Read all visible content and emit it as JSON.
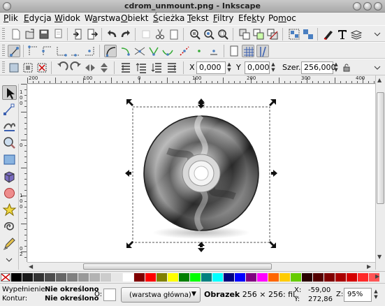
{
  "window": {
    "title": "cdrom_unmount.png - Inkscape"
  },
  "menu": [
    {
      "pre": "",
      "ul": "P",
      "post": "lik"
    },
    {
      "pre": "",
      "ul": "E",
      "post": "dycja"
    },
    {
      "pre": "",
      "ul": "W",
      "post": "idok"
    },
    {
      "pre": "W",
      "ul": "a",
      "post": "rstwa"
    },
    {
      "pre": "",
      "ul": "O",
      "post": "biekt"
    },
    {
      "pre": "",
      "ul": "Ś",
      "post": "cieżka"
    },
    {
      "pre": "",
      "ul": "T",
      "post": "ekst"
    },
    {
      "pre": "",
      "ul": "F",
      "post": "iltry"
    },
    {
      "pre": "Efe",
      "ul": "k",
      "post": "ty"
    },
    {
      "pre": "Po",
      "ul": "m",
      "post": "oc"
    }
  ],
  "controls": {
    "x_label": "X",
    "x_value": "0,000",
    "y_label": "Y",
    "y_value": "0,000",
    "w_label": "Szer.",
    "w_value": "256,000"
  },
  "rulers": {
    "h_ticks": [
      "200",
      "100",
      "0",
      "100",
      "200",
      "300",
      "400"
    ],
    "v_ticks": [
      "1",
      "0",
      "0",
      "0",
      "1",
      "0",
      "0",
      "0",
      "2"
    ]
  },
  "palette": [
    "#000000",
    "#1a1a1a",
    "#333333",
    "#4d4d4d",
    "#666666",
    "#808080",
    "#999999",
    "#b3b3b3",
    "#cccccc",
    "#e6e6e6",
    "#ffffff",
    "#800000",
    "#ff0000",
    "#808000",
    "#ffff00",
    "#008000",
    "#00ff00",
    "#008080",
    "#00ffff",
    "#000080",
    "#0000ff",
    "#800080",
    "#ff00ff",
    "#ff6600",
    "#ffcc00",
    "#66cc00",
    "#2b0000",
    "#550000",
    "#800000",
    "#aa0000",
    "#d40000",
    "#ff2a2a",
    "#ff5555"
  ],
  "status": {
    "fill_label": "Wypełnienie:",
    "fill_value": "Nie określono",
    "stroke_label": "Kontur:",
    "stroke_value": "Nie określono",
    "opacity_label": "O:",
    "layer": "(warstwa główna)",
    "message_bold": "Obrazek",
    "message": " 256 × 256: fil.",
    "x_label": "X:",
    "x": "-59,00",
    "y_label": "Y:",
    "y": "272,86",
    "zoom_label": "Z:",
    "zoom": "95%"
  }
}
